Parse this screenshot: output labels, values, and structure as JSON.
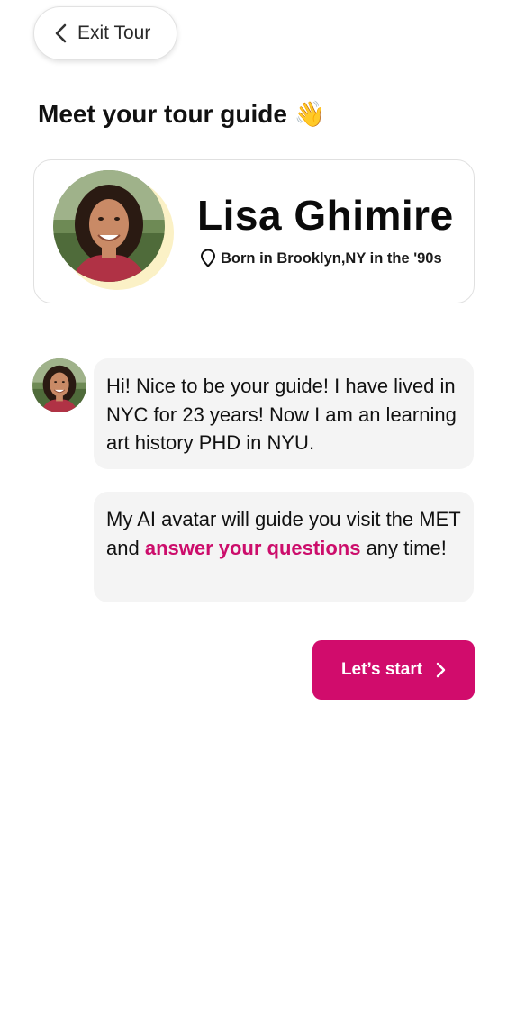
{
  "header": {
    "exit_label": "Exit Tour",
    "exit_icon": "chevron-left-icon"
  },
  "intro": {
    "title": "Meet your tour guide",
    "emoji": "👋"
  },
  "guide": {
    "name": "Lisa Ghimire",
    "location_icon": "location-pin-icon",
    "location": "Born in Brooklyn,NY in the '90s"
  },
  "messages": [
    {
      "text": "Hi! Nice to be your guide! I have lived in NYC for 23 years! Now I am an learning art history PHD in NYU."
    },
    {
      "text_before": "My AI avatar will guide you visit the MET and ",
      "highlight": "answer your questions",
      "text_after": " any time!"
    }
  ],
  "cta": {
    "label": "Let’s start",
    "icon": "chevron-right-icon"
  },
  "colors": {
    "accent": "#d10c6c",
    "highlight_text": "#cc0d6b",
    "bubble_bg": "#f4f4f4",
    "avatar_halo": "#fbf1c6"
  }
}
